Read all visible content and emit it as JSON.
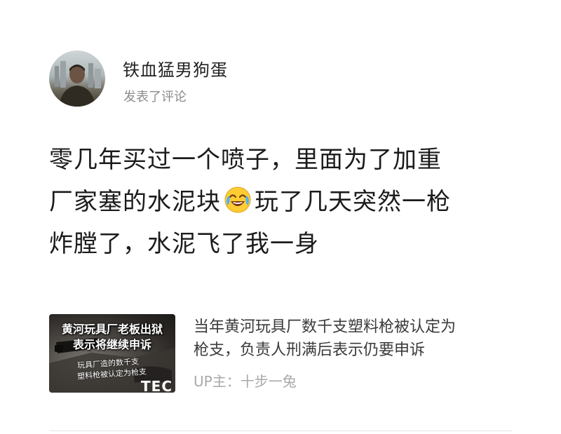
{
  "comment": {
    "username": "铁血猛男狗蛋",
    "action": "发表了评论",
    "body_lines": [
      [
        "零几年买过一个喷子，里面为了加重"
      ],
      [
        "厂家塞的水泥块",
        "玩了几天突然一枪"
      ],
      [
        "炸膛了，水泥飞了我一身"
      ]
    ],
    "emoji_name": "laugh-cry-emoji"
  },
  "video_card": {
    "thumbnail_text": {
      "headline_1": "黄河玩具厂老板出狱",
      "headline_2": "表示将继续申诉",
      "caption_1": "玩具厂造的数千支",
      "caption_2": "塑料枪被认定为枪支",
      "logo": "TEC"
    },
    "title_lines": [
      "当年黄河玩具厂数千支塑料枪被认定为",
      "枪支，负责人刑满后表示仍要申诉"
    ],
    "uploader": "UP主：十步一兔"
  },
  "colors": {
    "username": "#222222",
    "meta": "#8c8c8c",
    "body": "#1b1b1b",
    "card_title": "#3a3a3a",
    "card_meta": "#a9a9a9",
    "divider": "#e5e5e5"
  }
}
